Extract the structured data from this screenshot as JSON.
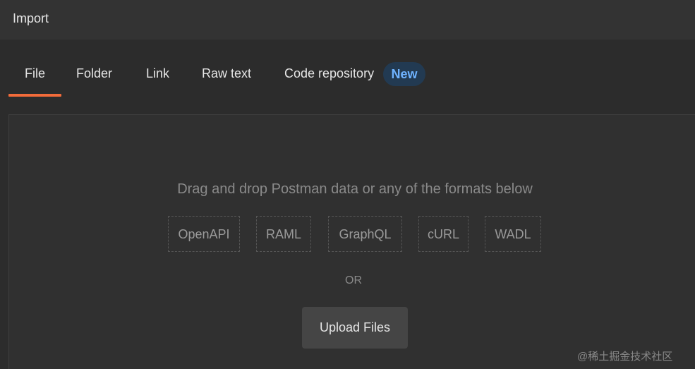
{
  "window": {
    "title": "Import"
  },
  "tabs": [
    {
      "label": "File",
      "active": true
    },
    {
      "label": "Folder",
      "active": false
    },
    {
      "label": "Link",
      "active": false
    },
    {
      "label": "Raw text",
      "active": false
    },
    {
      "label": "Code repository",
      "active": false,
      "badge": "New"
    }
  ],
  "dropzone": {
    "headline": "Drag and drop Postman data or any of the formats below",
    "formats": [
      "OpenAPI",
      "RAML",
      "GraphQL",
      "cURL",
      "WADL"
    ],
    "or_label": "OR",
    "upload_label": "Upload Files"
  },
  "watermark": "@稀土掘金技术社区",
  "colors": {
    "accent": "#f26b3a",
    "badge_bg": "#223a52",
    "badge_text": "#6fb3ff",
    "background": "#2c2c2c"
  }
}
